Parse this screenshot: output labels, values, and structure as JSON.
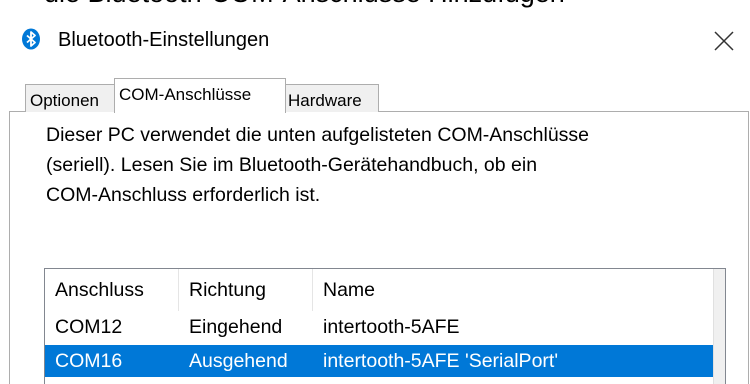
{
  "clipped_text": "die Bluetooth-COM-Anschlüsse Hinzufügen",
  "window": {
    "title": "Bluetooth-Einstellungen",
    "icon": "bluetooth-icon",
    "close_icon": "close-icon"
  },
  "tabs": [
    {
      "label": "Optionen",
      "active": false
    },
    {
      "label": "COM-Anschlüsse",
      "active": true
    },
    {
      "label": "Hardware",
      "active": false
    }
  ],
  "description": {
    "line1": "Dieser PC verwendet die unten aufgelisteten COM-Anschlüsse",
    "line2": "(seriell). Lesen Sie im Bluetooth-Gerätehandbuch, ob ein",
    "line3": "COM-Anschluss erforderlich ist."
  },
  "ports_table": {
    "columns": [
      "Anschluss",
      "Richtung",
      "Name"
    ],
    "rows": [
      {
        "port": "COM12",
        "direction": "Eingehend",
        "name": "intertooth-5AFE",
        "selected": false
      },
      {
        "port": "COM16",
        "direction": "Ausgehend",
        "name": "intertooth-5AFE 'SerialPort'",
        "selected": true
      }
    ]
  },
  "colors": {
    "selection": "#0078d7",
    "bluetooth": "#0078d7",
    "tab_bg": "#f0f0f0"
  }
}
